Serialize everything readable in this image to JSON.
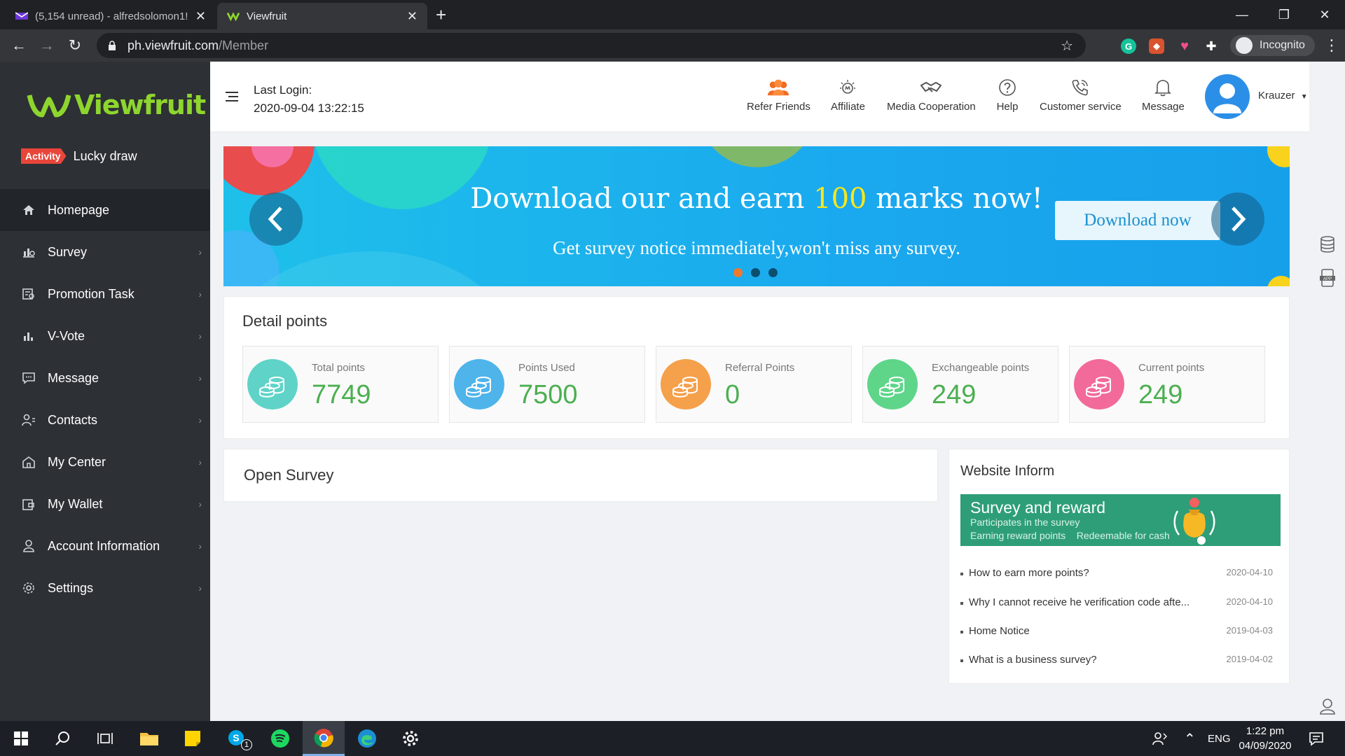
{
  "browser": {
    "tabs": [
      {
        "title": "(5,154 unread) - alfredsolomon1!",
        "active": false
      },
      {
        "title": "Viewfruit",
        "active": true
      }
    ],
    "url_host": "ph.viewfruit.com",
    "url_path": "/Member",
    "incognito_label": "Incognito"
  },
  "sidebar": {
    "logo_text": "Viewfruit",
    "activity_badge": "Activity",
    "activity_label": "Lucky draw",
    "items": [
      {
        "label": "Homepage",
        "icon": "home-icon",
        "active": true
      },
      {
        "label": "Survey",
        "icon": "survey-chart-icon"
      },
      {
        "label": "Promotion Task",
        "icon": "promotion-task-icon"
      },
      {
        "label": "V-Vote",
        "icon": "bar-chart-icon"
      },
      {
        "label": "Message",
        "icon": "chat-bubble-icon"
      },
      {
        "label": "Contacts",
        "icon": "contacts-icon"
      },
      {
        "label": "My Center",
        "icon": "center-home-icon"
      },
      {
        "label": "My Wallet",
        "icon": "wallet-icon"
      },
      {
        "label": "Account Information",
        "icon": "user-icon"
      },
      {
        "label": "Settings",
        "icon": "gear-icon"
      }
    ]
  },
  "header": {
    "last_login_label": "Last Login:",
    "last_login_value": "2020-09-04 13:22:15",
    "nav": [
      {
        "label": "Refer Friends",
        "icon": "refer-friends-icon"
      },
      {
        "label": "Affiliate",
        "icon": "affiliate-icon"
      },
      {
        "label": "Media Cooperation",
        "icon": "handshake-icon"
      },
      {
        "label": "Help",
        "icon": "help-icon"
      },
      {
        "label": "Customer service",
        "icon": "phone-icon"
      },
      {
        "label": "Message",
        "icon": "bell-icon"
      }
    ],
    "username": "Krauzer"
  },
  "banner": {
    "title_pre": "Download our and earn ",
    "title_highlight": "100",
    "title_post": " marks now!",
    "subtitle": "Get survey notice immediately,won't miss any survey.",
    "button": "Download now",
    "active_slide": 1,
    "slide_count": 3
  },
  "points": {
    "title": "Detail points",
    "cards": [
      {
        "label": "Total points",
        "value": "7749",
        "color": "#5fd3c7"
      },
      {
        "label": "Points Used",
        "value": "7500",
        "color": "#4eb4ea"
      },
      {
        "label": "Referral Points",
        "value": "0",
        "color": "#f5a04a"
      },
      {
        "label": "Exchangeable points",
        "value": "249",
        "color": "#5fd58a"
      },
      {
        "label": "Current points",
        "value": "249",
        "color": "#f16a9a"
      }
    ]
  },
  "open_survey": {
    "title": "Open Survey"
  },
  "website_inform": {
    "title": "Website Inform",
    "banner_title": "Survey and reward",
    "banner_line1": "Participates in the survey",
    "banner_line2": "Earning reward points    Redeemable for cash",
    "news": [
      {
        "text": "How to earn more points?",
        "date": "2020-04-10"
      },
      {
        "text": "Why I cannot receive he verification code afte...",
        "date": "2020-04-10"
      },
      {
        "text": "Home Notice",
        "date": "2019-04-03"
      },
      {
        "text": "What is a business survey?",
        "date": "2019-04-02"
      }
    ]
  },
  "taskbar": {
    "lang": "ENG",
    "time": "1:22 pm",
    "date": "04/09/2020",
    "skype_badge": "1"
  },
  "colors": {
    "sidebar_bg": "#2d3035",
    "accent_green": "#4caf50",
    "brand_green": "#8ed62d",
    "banner_blue": "#1aa8ee"
  }
}
